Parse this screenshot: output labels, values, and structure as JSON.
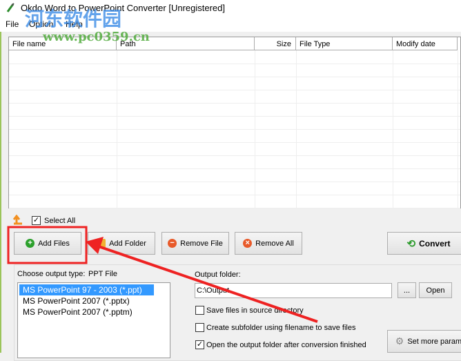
{
  "window": {
    "title": "Okdo Word to PowerPoint Converter [Unregistered]"
  },
  "menu": [
    "File",
    "Option",
    "Help"
  ],
  "file_list": {
    "columns": [
      "File name",
      "Path",
      "Size",
      "File Type",
      "Modify date"
    ],
    "rows": []
  },
  "select_all": {
    "label": "Select All",
    "checked": true
  },
  "buttons": {
    "add_files": "Add Files",
    "add_folder": "Add Folder",
    "remove_file": "Remove File",
    "remove_all": "Remove All",
    "convert": "Convert",
    "browse": "...",
    "open": "Open",
    "set_more": "Set more param"
  },
  "output_type": {
    "label": "Choose output type:",
    "value": "PPT File",
    "options": [
      "MS PowerPoint 97 - 2003 (*.ppt)",
      "MS PowerPoint 2007 (*.pptx)",
      "MS PowerPoint 2007 (*.pptm)"
    ],
    "selected": 0
  },
  "output_folder": {
    "label": "Output folder:",
    "value": "C:\\Output"
  },
  "options": [
    {
      "label": "Save files in source directory",
      "checked": false
    },
    {
      "label": "Create subfolder using filename to save files",
      "checked": false
    },
    {
      "label": "Open the output folder after conversion finished",
      "checked": true
    }
  ],
  "watermark": {
    "site_name": "河东软件园",
    "url": "www.pc0359.cn"
  },
  "colors": {
    "selection": "#3399ff",
    "annotation": "#ee2222"
  }
}
